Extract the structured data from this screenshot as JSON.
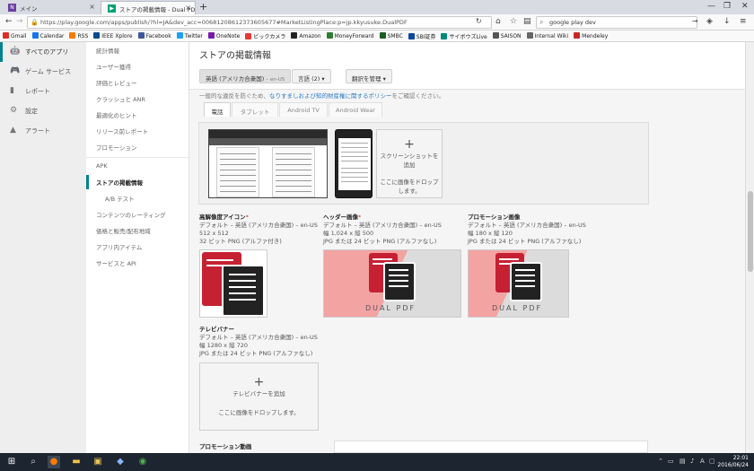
{
  "browser": {
    "tabs": [
      {
        "label": "メイン",
        "icon": "N"
      },
      {
        "label": "ストアの掲載情報 - Dual PD...",
        "icon": "▶"
      }
    ],
    "url": "https://play.google.com/apps/publish/?hl=JA&dev_acc=00681208612373605677#MarketListingPlace:p=jp.kkyusuke.DualPDF",
    "search": "google play dev",
    "bookmarks": [
      "Gmail",
      "Calendar",
      "RSS",
      "IEEE Xplore",
      "Facebook",
      "Twitter",
      "OneNote",
      "ビックカメラ",
      "Amazon",
      "MoneyForward",
      "SMBC",
      "SBI証券",
      "サイボウズLive",
      "SAISON",
      "Internal Wiki",
      "Mendeley"
    ],
    "bookmark_colors": [
      "#d93025",
      "#1a73e8",
      "#f57c00",
      "#0a4a8a",
      "#3b5998",
      "#1da1f2",
      "#7719aa",
      "#e53935",
      "#222222",
      "#2e7d32",
      "#1b5e20",
      "#0d47a1",
      "#00897b",
      "#555555",
      "#666666",
      "#c62828"
    ]
  },
  "rail": {
    "items": [
      {
        "label": "すべてのアプリ",
        "icon": "android-icon"
      },
      {
        "label": "ゲーム サービス",
        "icon": "gamepad-icon"
      },
      {
        "label": "レポート",
        "icon": "report-icon"
      },
      {
        "label": "設定",
        "icon": "gear-icon"
      },
      {
        "label": "アラート",
        "icon": "alert-icon"
      }
    ]
  },
  "subnav": {
    "group1": [
      "統計情報",
      "ユーザー獲得",
      "評価とレビュー",
      "クラッシュと ANR",
      "最適化のヒント",
      "リリース前レポート",
      "プロモーション"
    ],
    "group2": [
      "APK",
      "ストアの掲載情報",
      "A/B テスト",
      "コンテンツのレーティング",
      "価格と販売/配布地域",
      "アプリ内アイテム",
      "サービスと API"
    ]
  },
  "main": {
    "title": "ストアの掲載情報",
    "language_btn": {
      "label": "英語 (アメリカ合衆国)",
      "code": "– en-US"
    },
    "languages_btn": "言語 (2)",
    "translate_btn": "翻訳を管理",
    "policy": {
      "prefix": "一般的な違反を防ぐため、",
      "link": "なりすましおよび知的財産権に関するポリシー",
      "suffix": "をご確認ください。"
    },
    "form_tabs": [
      "電話",
      "タブレット",
      "Android TV",
      "Android Wear"
    ],
    "add_screenshot": {
      "plus": "+",
      "title": "スクリーンショットを追加",
      "drop": "ここに画像をドロップします。"
    },
    "assets": [
      {
        "title": "高解像度アイコン",
        "required": "*",
        "lines": [
          "デフォルト – 英語 (アメリカ合衆国) – en-US",
          "512 x 512",
          "32 ビット PNG (アルファ付き)"
        ]
      },
      {
        "title": "ヘッダー画像",
        "required": "*",
        "lines": [
          "デフォルト – 英語 (アメリカ合衆国) – en-US",
          "幅 1,024 x 縦 500",
          "JPG または 24 ビット PNG (アルファなし)"
        ]
      },
      {
        "title": "プロモーション画像",
        "required": "",
        "lines": [
          "デフォルト – 英語 (アメリカ合衆国) – en-US",
          "幅 180 x 縦 120",
          "JPG または 24 ビット PNG (アルファなし)"
        ]
      },
      {
        "title": "テレビバナー",
        "required": "",
        "lines": [
          "デフォルト – 英語 (アメリカ合衆国) – en-US",
          "幅 1280 x 縦 720",
          "JPG または 24 ビット PNG (アルファなし)"
        ]
      }
    ],
    "brand": "DUAL PDF",
    "add_banner": {
      "plus": "+",
      "title": "テレビバナーを追加",
      "drop": "ここに画像をドロップします。"
    },
    "promo_video": "プロモーション動画"
  },
  "taskbar": {
    "time": "22:01",
    "date": "2016/06/24"
  },
  "colors": {
    "accent": "#00838f",
    "brand_red": "#c62033",
    "link": "#2a79c4"
  }
}
